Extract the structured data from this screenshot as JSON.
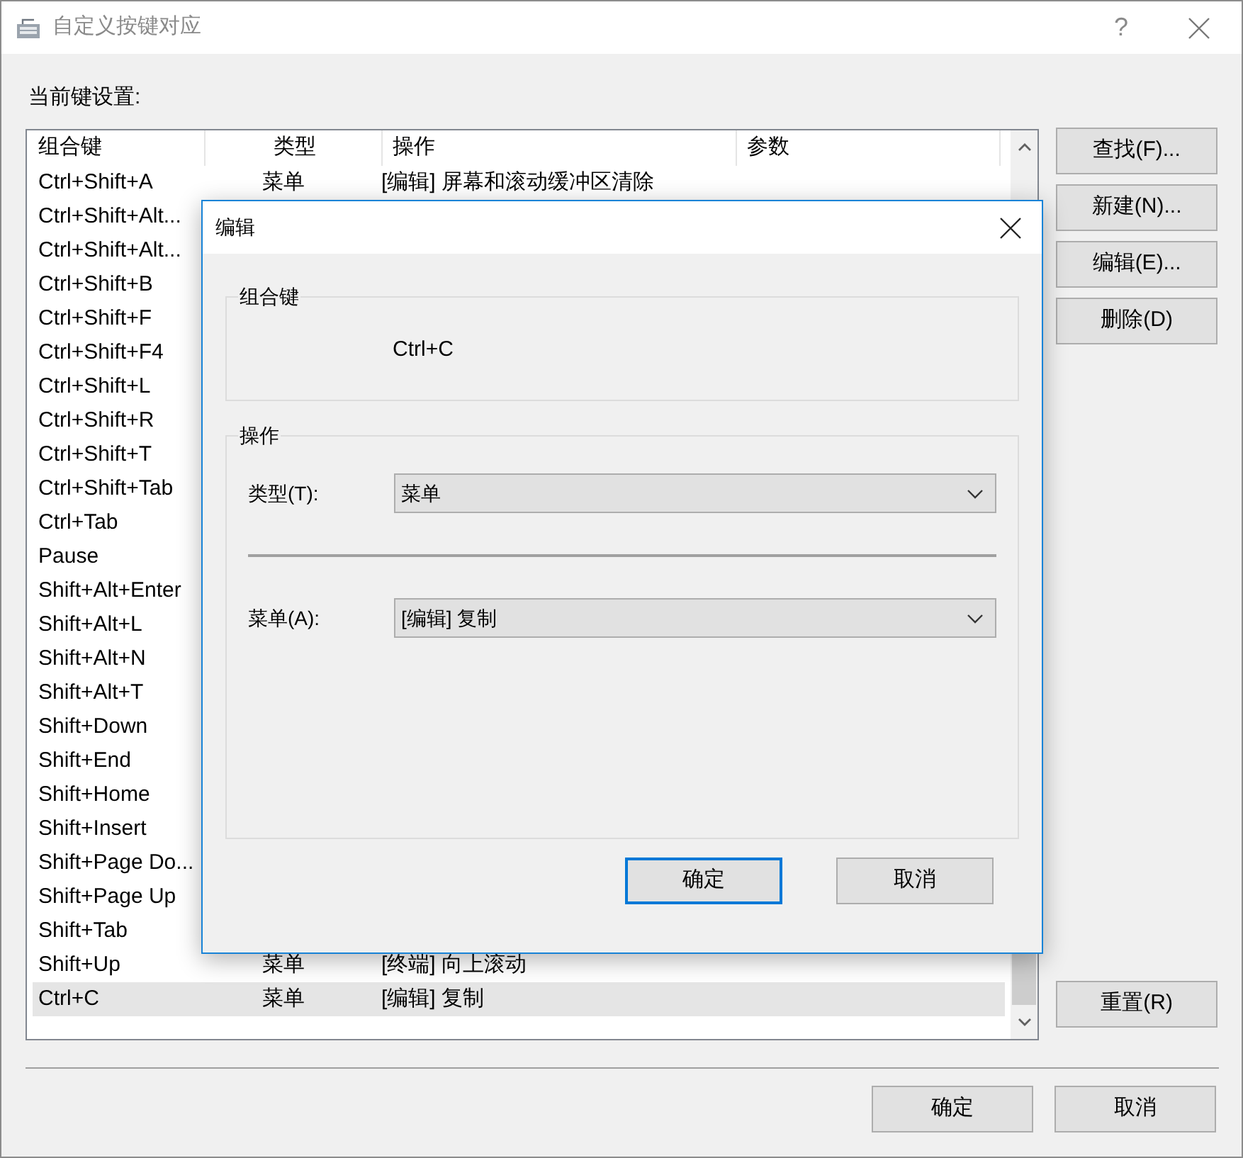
{
  "window": {
    "title": "自定义按键对应",
    "help": "?"
  },
  "current_label": "当前键设置:",
  "table": {
    "columns": [
      "组合键",
      "类型",
      "操作",
      "参数"
    ],
    "rows": [
      {
        "key": "Ctrl+Shift+A",
        "type": "菜单",
        "action": "[编辑] 屏幕和滚动缓冲区清除",
        "selected": false
      },
      {
        "key": "Ctrl+Shift+Alt...",
        "selected": false
      },
      {
        "key": "Ctrl+Shift+Alt...",
        "selected": false
      },
      {
        "key": "Ctrl+Shift+B",
        "selected": false
      },
      {
        "key": "Ctrl+Shift+F",
        "selected": false
      },
      {
        "key": "Ctrl+Shift+F4",
        "selected": false
      },
      {
        "key": "Ctrl+Shift+L",
        "selected": false
      },
      {
        "key": "Ctrl+Shift+R",
        "selected": false
      },
      {
        "key": "Ctrl+Shift+T",
        "selected": false
      },
      {
        "key": "Ctrl+Shift+Tab",
        "selected": false
      },
      {
        "key": "Ctrl+Tab",
        "selected": false
      },
      {
        "key": "Pause",
        "selected": false
      },
      {
        "key": "Shift+Alt+Enter",
        "selected": false
      },
      {
        "key": "Shift+Alt+L",
        "selected": false
      },
      {
        "key": "Shift+Alt+N",
        "selected": false
      },
      {
        "key": "Shift+Alt+T",
        "selected": false
      },
      {
        "key": "Shift+Down",
        "selected": false
      },
      {
        "key": "Shift+End",
        "selected": false
      },
      {
        "key": "Shift+Home",
        "selected": false
      },
      {
        "key": "Shift+Insert",
        "selected": false
      },
      {
        "key": "Shift+Page Do...",
        "selected": false
      },
      {
        "key": "Shift+Page Up",
        "selected": false
      },
      {
        "key": "Shift+Tab",
        "selected": false
      },
      {
        "key": "Shift+Up",
        "type": "菜单",
        "action": "[终端] 向上滚动",
        "selected": false
      },
      {
        "key": "Ctrl+C",
        "type": "菜单",
        "action": "[编辑] 复制",
        "selected": true
      }
    ]
  },
  "side_buttons": [
    "查找(F)...",
    "新建(N)...",
    "编辑(E)...",
    "删除(D)"
  ],
  "reset_button": "重置(R)",
  "footer_buttons": [
    "确定",
    "取消"
  ],
  "dialog": {
    "title": "编辑",
    "key_group": {
      "label": "组合键",
      "value": "Ctrl+C"
    },
    "action_group": {
      "label": "操作",
      "fields": [
        {
          "label": "类型(T):",
          "value": "菜单"
        },
        {
          "label": "菜单(A):",
          "value": "[编辑] 复制"
        }
      ]
    },
    "buttons": [
      {
        "label": "确定",
        "focused": true
      },
      {
        "label": "取消",
        "focused": false
      }
    ]
  }
}
